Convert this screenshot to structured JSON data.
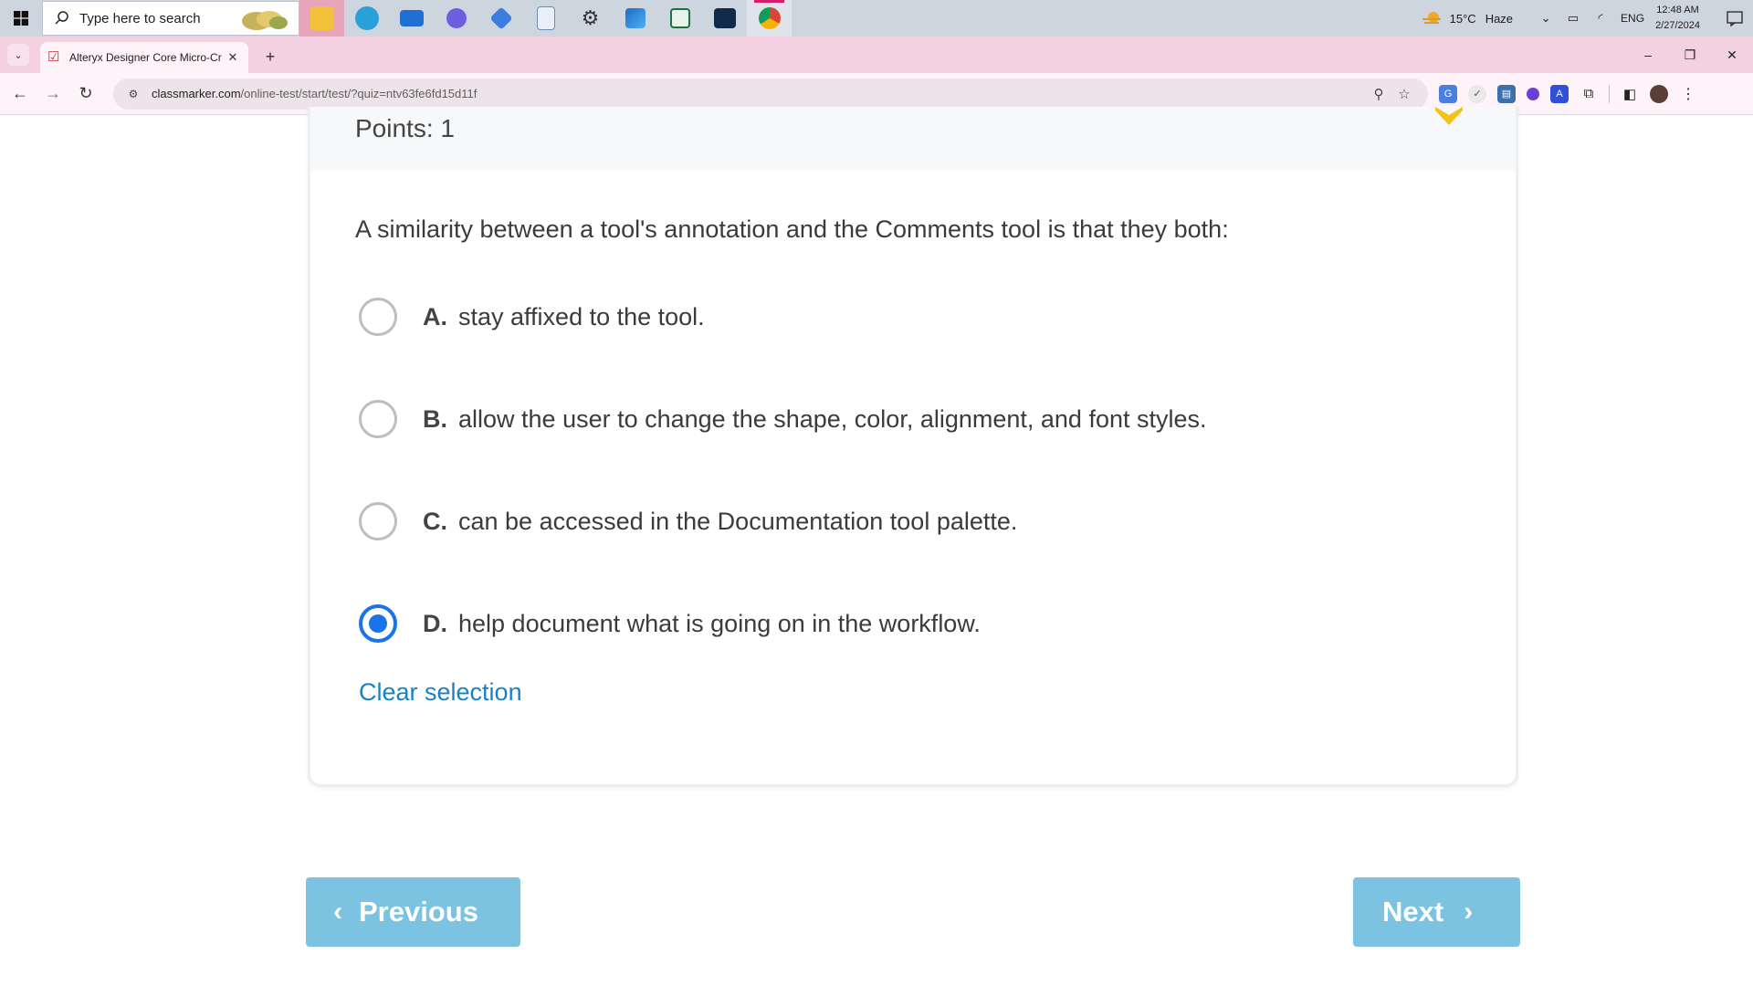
{
  "taskbar": {
    "search_placeholder": "Type here to search",
    "apps": [
      "file-explorer",
      "edge",
      "mail",
      "copilot",
      "teams",
      "docs",
      "settings",
      "photos",
      "excel",
      "media",
      "chrome"
    ],
    "weather_temp": "15°C",
    "weather_desc": "Haze",
    "language": "ENG",
    "time": "12:48 AM",
    "date": "2/27/2024"
  },
  "browser": {
    "tab_title": "Alteryx Designer Core Micro-Cr",
    "url_domain": "classmarker.com",
    "url_path": "/online-test/start/test/?quiz=ntv63fe6fd15d11f",
    "new_tab_label": "+",
    "close_tab_label": "✕"
  },
  "quiz": {
    "points": "Points: 1",
    "question": "A similarity between a tool's annotation and the Comments tool is that they both:",
    "options": [
      {
        "letter": "A.",
        "text": "stay affixed to the tool.",
        "selected": false
      },
      {
        "letter": "B.",
        "text": "allow the user to change the shape, color, alignment, and font styles.",
        "selected": false
      },
      {
        "letter": "C.",
        "text": "can be accessed in the Documentation tool palette.",
        "selected": false
      },
      {
        "letter": "D.",
        "text": "help document what is going on in the workflow.",
        "selected": true
      }
    ],
    "clear_label": "Clear selection",
    "prev_label": "Previous",
    "next_label": "Next"
  },
  "colors": {
    "accent": "#1a73e8",
    "link": "#1a82c4",
    "button": "#7cc3e2",
    "tab_strip": "#f3d1e0"
  }
}
